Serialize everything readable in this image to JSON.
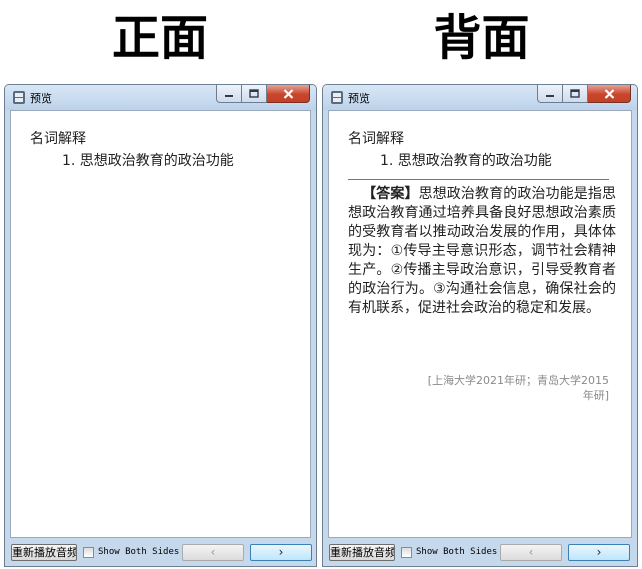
{
  "headings": {
    "front": "正面",
    "back": "背面"
  },
  "window": {
    "title": "预览",
    "icon": "app-preview-icon",
    "close_color": "#c9462c"
  },
  "front": {
    "term_title": "名词解释",
    "term_item": "1. 思想政治教育的政治功能"
  },
  "back": {
    "term_title": "名词解释",
    "term_item": "1. 思想政治教育的政治功能",
    "answer_label": "【答案】",
    "answer_text": "思想政治教育的政治功能是指思想政治教育通过培养具备良好思想政治素质的受教育者以推动政治发展的作用，具体体现为：①传导主导意识形态，调节社会精神生产。②传播主导政治意识，引导受教育者的政治行为。③沟通社会信息，确保社会的有机联系，促进社会政治的稳定和发展。",
    "source": "[上海大学2021年研；青岛大学2015年研]"
  },
  "bottombar": {
    "play_label": "重新播放音频",
    "show_both_label": "Show Both Sides",
    "prev_label": "‹",
    "next_label": "›"
  }
}
